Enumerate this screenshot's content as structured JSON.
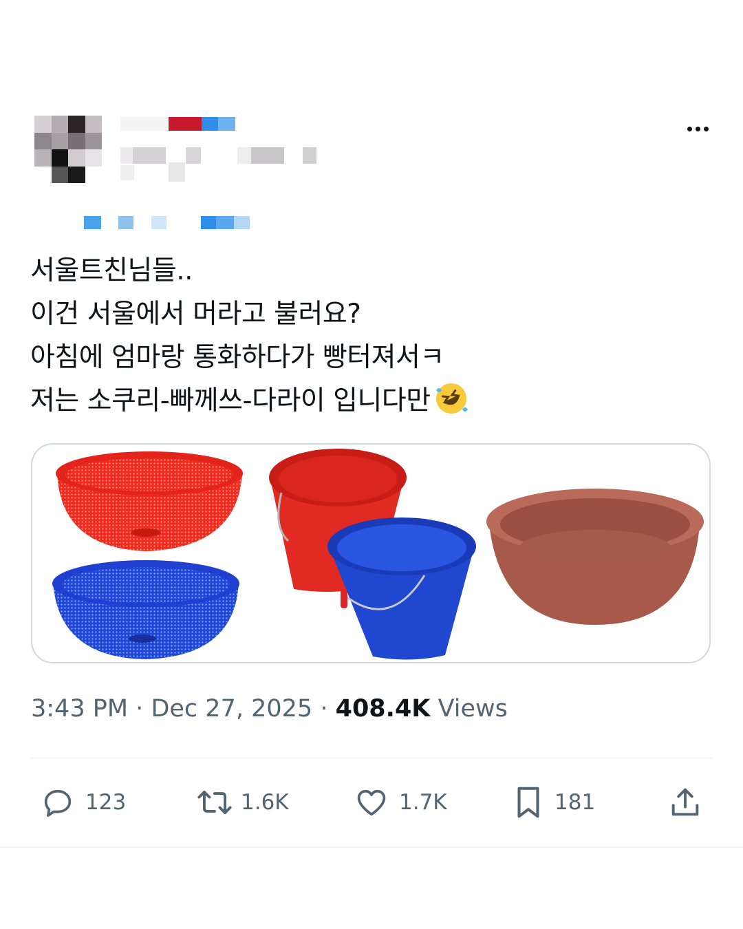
{
  "tweet": {
    "text_lines": [
      "서울트친님들..",
      "이건 서울에서 머라고 불러요?",
      "아침에 엄마랑 통화하다가 빵터져서ㅋ",
      "저는 소쿠리-빠께쓰-다라이 입니다만"
    ],
    "emoji": "rolling-on-the-floor-laughing"
  },
  "meta": {
    "time": "3:43 PM",
    "separator": "·",
    "date": "Dec 27, 2025",
    "views_count": "408.4K",
    "views_label": "Views"
  },
  "actions": {
    "replies": "123",
    "reposts": "1.6K",
    "likes": "1.7K",
    "bookmarks": "181"
  },
  "colors": {
    "text": "#0f1419",
    "secondary": "#536471",
    "border": "#cfd9de"
  }
}
